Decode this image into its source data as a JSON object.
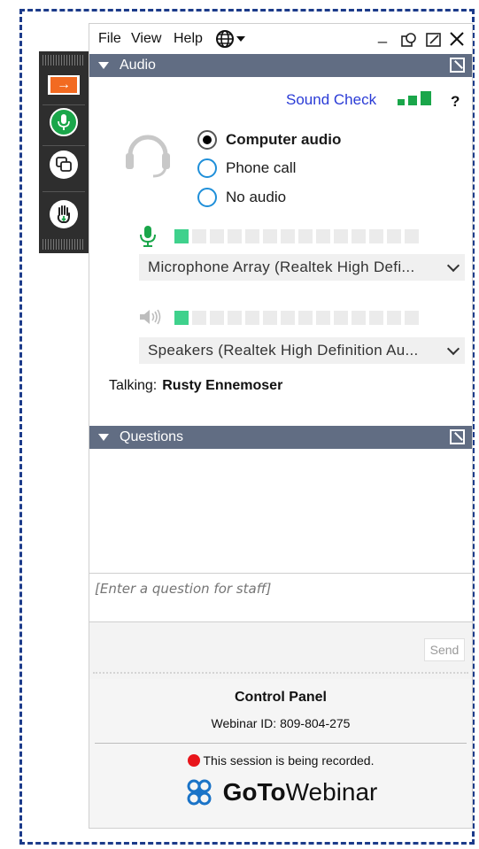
{
  "menu": {
    "file": "File",
    "view": "View",
    "help": "Help"
  },
  "audio": {
    "title": "Audio",
    "sound_check": "Sound Check",
    "help_symbol": "?",
    "options": [
      "Computer audio",
      "Phone call",
      "No audio"
    ],
    "selected_option": "Computer audio",
    "microphone": {
      "level_segments_on": 1,
      "level_segments_total": 14,
      "device": "Microphone Array (Realtek High Defi..."
    },
    "speakers": {
      "level_segments_on": 1,
      "level_segments_total": 14,
      "device": "Speakers (Realtek High Definition Au..."
    },
    "talking_label": "Talking:",
    "talking_name": "Rusty Ennemoser"
  },
  "questions": {
    "title": "Questions",
    "input_placeholder": "[Enter a question for staff]",
    "send_label": "Send"
  },
  "footer": {
    "title": "Control Panel",
    "webinar_id": "Webinar ID: 809-804-275",
    "recording": "This session is being recorded.",
    "brand_goto": "GoTo",
    "brand_webinar": "Webinar"
  },
  "colors": {
    "section_header": "#616d83",
    "accent_orange": "#f26a21",
    "mic_green": "#1aa64a",
    "meter_on": "#3fd18c",
    "link_blue": "#2a3bd6",
    "record_red": "#e8151b",
    "frame_dash": "#1c3b8a"
  },
  "icons": {
    "side": [
      "arrow-right-icon",
      "microphone-icon",
      "screen-icon",
      "raise-hand-icon"
    ],
    "window": [
      "minimize-icon",
      "restore-icon",
      "popout-icon",
      "close-icon"
    ]
  }
}
